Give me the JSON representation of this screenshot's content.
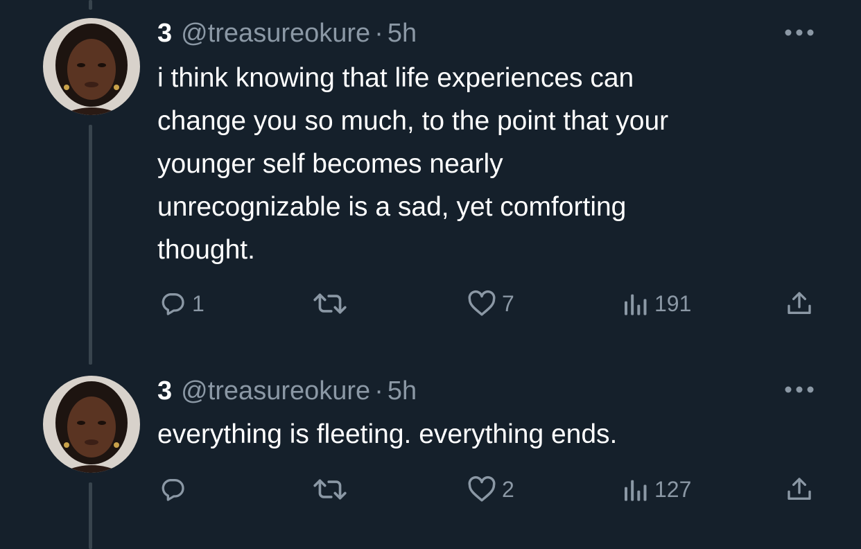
{
  "tweets": [
    {
      "display_name": "3",
      "handle": "@treasureokure",
      "separator": "·",
      "time": "5h",
      "text": "i think knowing that life experiences can\nchange you so much, to the point that your\nyounger self becomes nearly\nunrecognizable is a sad, yet comforting\nthought.",
      "replies": "1",
      "retweets": "",
      "likes": "7",
      "views": "191"
    },
    {
      "display_name": "3",
      "handle": "@treasureokure",
      "separator": "·",
      "time": "5h",
      "text": "everything is fleeting. everything ends.",
      "replies": "",
      "retweets": "",
      "likes": "2",
      "views": "127"
    }
  ],
  "icons": {
    "more": "more-horizontal-icon",
    "reply": "reply-bubble-icon",
    "retweet": "retweet-arrows-icon",
    "like": "heart-outline-icon",
    "views": "bar-chart-icon",
    "share": "share-upload-icon"
  },
  "colors": {
    "background": "#15202b",
    "text_primary": "#ffffff",
    "text_secondary": "#8b98a5",
    "thread_line": "#38444d"
  }
}
